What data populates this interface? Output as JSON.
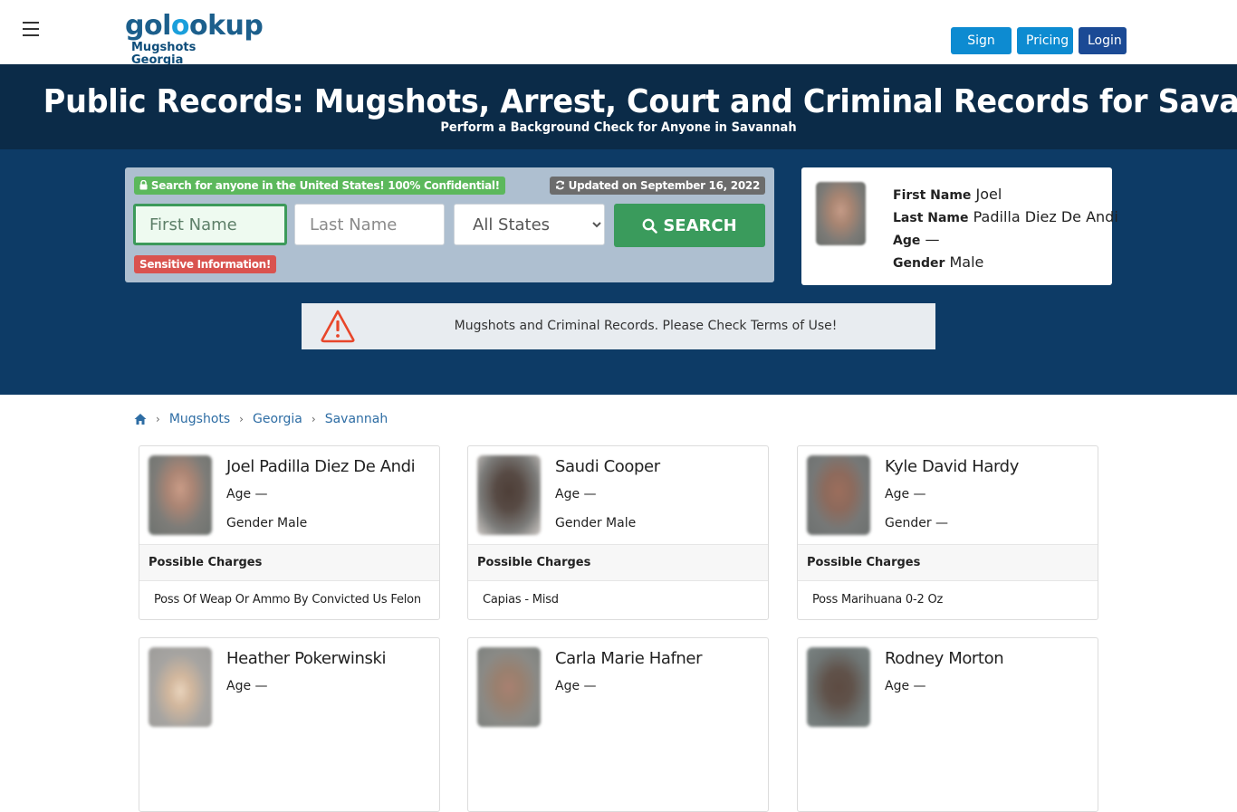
{
  "header": {
    "logo_text_pre": "gol",
    "logo_text_accent": "o",
    "logo_text_post": "okup",
    "logo_subtitle": "Mugshots Georgia",
    "buttons": {
      "signup": "Sign Up",
      "pricing": "Pricing",
      "login": "Login"
    },
    "colors": {
      "signup": "#0d8bd1",
      "pricing": "#0d8bd1",
      "login": "#1b4a95"
    }
  },
  "hero": {
    "title": "Public Records: Mugshots, Arrest, Court and Criminal Records for Savannah!",
    "subtitle": "Perform a Background Check for Anyone in Savannah"
  },
  "search": {
    "confidential_badge": "Search for anyone in the United States! 100% Confidential!",
    "updated_badge": "Updated on September 16, 2022",
    "first_name_placeholder": "First Name",
    "last_name_placeholder": "Last Name",
    "state_selected": "All States",
    "search_label": "SEARCH",
    "sensitive_badge": "Sensitive Information!"
  },
  "featured_profile": {
    "first_name_label": "First Name",
    "first_name": "Joel",
    "last_name_label": "Last Name",
    "last_name": "Padilla Diez De Andi",
    "age_label": "Age",
    "age": "—",
    "gender_label": "Gender",
    "gender": "Male"
  },
  "notice": {
    "text": "Mugshots and Criminal Records. Please Check Terms of Use!"
  },
  "breadcrumb": {
    "home_icon": "home-icon",
    "items": [
      "Mugshots",
      "Georgia",
      "Savannah"
    ],
    "separator": "›"
  },
  "cards_labels": {
    "age": "Age",
    "gender": "Gender",
    "charges_header": "Possible Charges"
  },
  "cards": [
    {
      "name": "Joel Padilla Diez De Andi",
      "age": "—",
      "gender": "Male",
      "charge": "Poss Of Weap Or Ammo By Convicted Us Felon"
    },
    {
      "name": "Saudi Cooper",
      "age": "—",
      "gender": "Male",
      "charge": "Capias - Misd"
    },
    {
      "name": "Kyle David Hardy",
      "age": "—",
      "gender": "—",
      "charge": "Poss Marihuana 0-2 Oz"
    },
    {
      "name": "Heather Pokerwinski",
      "age": "—"
    },
    {
      "name": "Carla Marie Hafner",
      "age": "—"
    },
    {
      "name": "Rodney Morton",
      "age": "—"
    }
  ]
}
